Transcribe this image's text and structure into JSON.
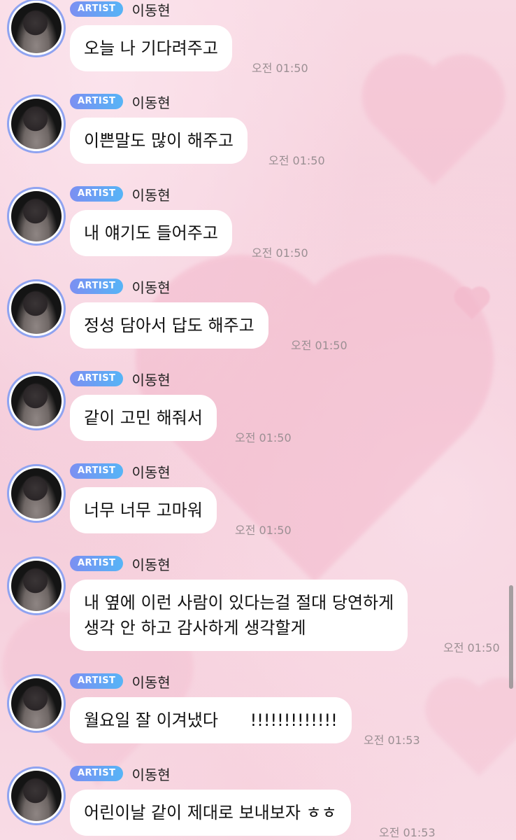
{
  "app": {
    "background": "pink hearts chat wallpaper",
    "badge_colors": [
      "#7c8ff2",
      "#56b4f6"
    ]
  },
  "messages": [
    {
      "badge": "ARTIST",
      "sender": "이동현",
      "text": "오늘 나 기다려주고",
      "time": "오전 01:50"
    },
    {
      "badge": "ARTIST",
      "sender": "이동현",
      "text": "이쁜말도 많이 해주고",
      "time": "오전 01:50"
    },
    {
      "badge": "ARTIST",
      "sender": "이동현",
      "text": "내 얘기도 들어주고",
      "time": "오전 01:50"
    },
    {
      "badge": "ARTIST",
      "sender": "이동현",
      "text": "정성 담아서 답도 해주고",
      "time": "오전 01:50"
    },
    {
      "badge": "ARTIST",
      "sender": "이동현",
      "text": "같이 고민 해줘서",
      "time": "오전 01:50"
    },
    {
      "badge": "ARTIST",
      "sender": "이동현",
      "text": "너무 너무 고마워",
      "time": "오전 01:50"
    },
    {
      "badge": "ARTIST",
      "sender": "이동현",
      "text_lines": [
        "내 옆에 이런 사람이 있다는걸 절대 당연하게",
        "생각 안 하고 감사하게 생각할게"
      ],
      "time": "오전 01:50"
    },
    {
      "badge": "ARTIST",
      "sender": "이동현",
      "text": "월요일 잘 이겨냈다      !!!!!!!!!!!!!",
      "time": "오전 01:53"
    },
    {
      "badge": "ARTIST",
      "sender": "이동현",
      "text": "어린이날 같이 제대로 보내보자 ㅎㅎ",
      "time": "오전 01:53"
    }
  ]
}
